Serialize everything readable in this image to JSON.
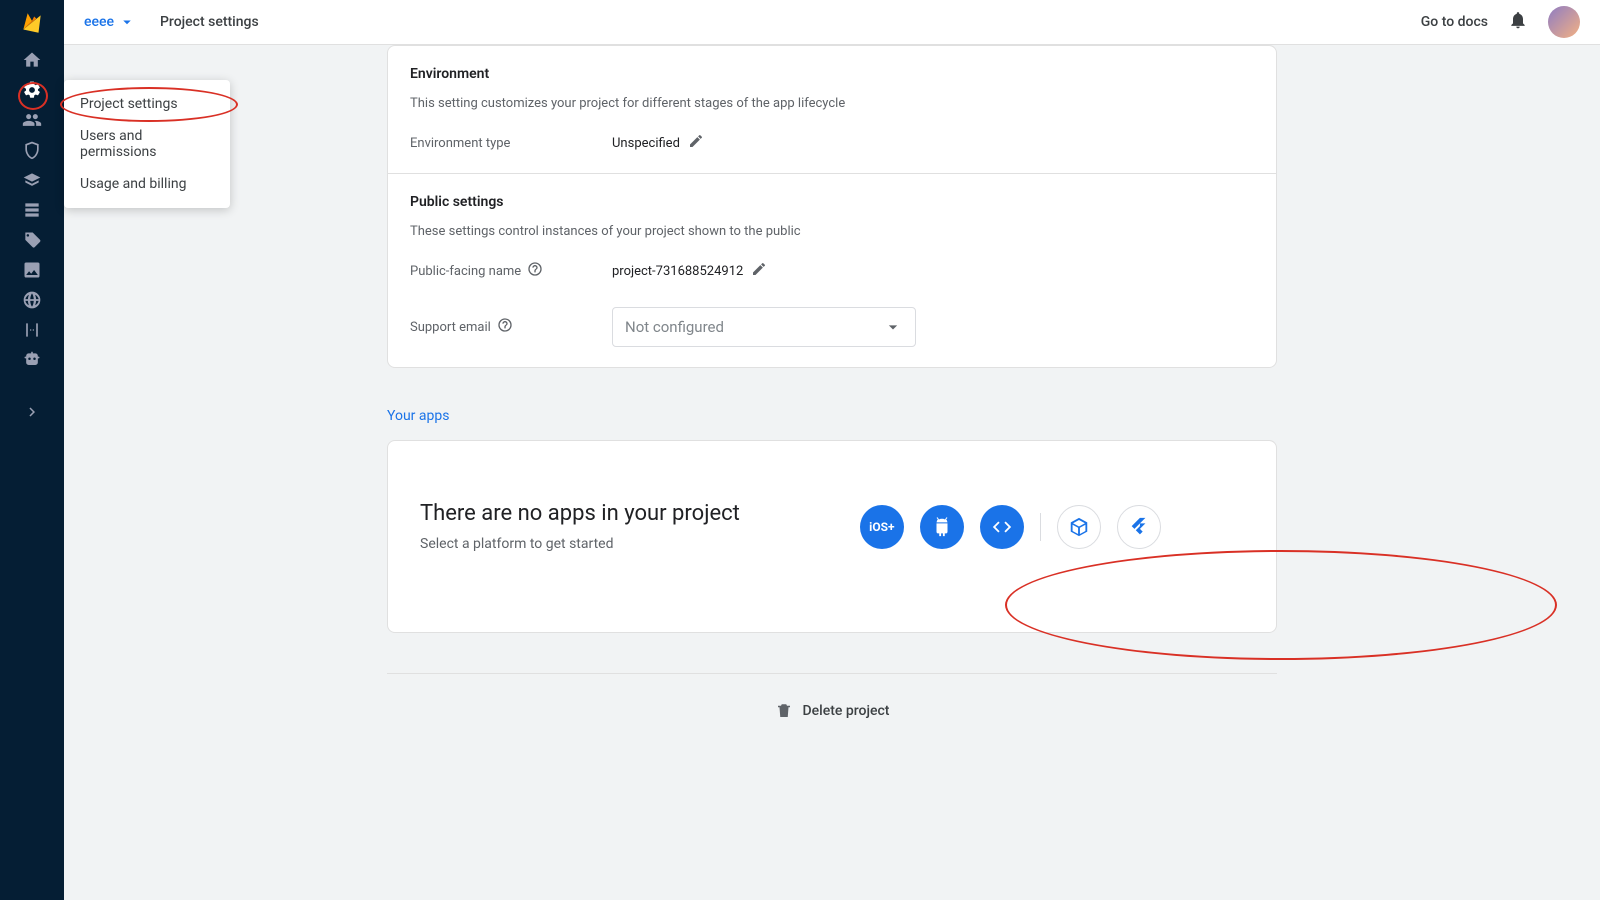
{
  "header": {
    "project_name": "eeee",
    "breadcrumb": "Project settings",
    "docs_label": "Go to docs"
  },
  "settings_menu": {
    "items": [
      {
        "label": "Project settings"
      },
      {
        "label": "Users and permissions"
      },
      {
        "label": "Usage and billing"
      }
    ]
  },
  "environment": {
    "title": "Environment",
    "desc": "This setting customizes your project for different stages of the app lifecycle",
    "type_label": "Environment type",
    "type_value": "Unspecified"
  },
  "public": {
    "title": "Public settings",
    "desc": "These settings control instances of your project shown to the public",
    "name_label": "Public-facing name",
    "name_value": "project-731688524912",
    "email_label": "Support email",
    "email_value": "Not configured"
  },
  "apps": {
    "section_label": "Your apps",
    "title": "There are no apps in your project",
    "sub": "Select a platform to get started",
    "platforms": {
      "ios": "iOS+",
      "android": "android",
      "web": "web",
      "unity": "unity",
      "flutter": "flutter"
    }
  },
  "delete_label": "Delete project",
  "colors": {
    "accent": "#1a73e8",
    "annotation": "#d93025",
    "sidebar_bg": "#051e34"
  }
}
